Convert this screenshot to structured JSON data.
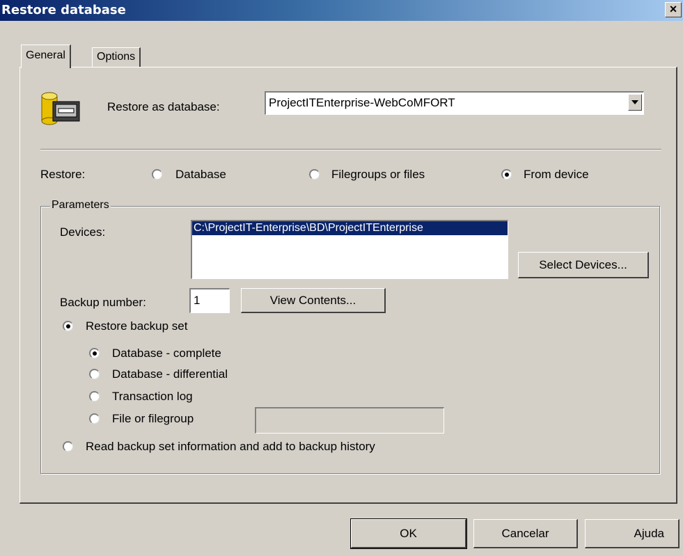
{
  "window": {
    "title": "Restore database",
    "close_glyph": "×"
  },
  "tabs": [
    {
      "label": "General",
      "active": true
    },
    {
      "label": "Options",
      "active": false
    }
  ],
  "restore_as": {
    "label": "Restore as database:",
    "value": "ProjectITEnterprise-WebCoMFORT",
    "icon": "database-icon"
  },
  "restore": {
    "label": "Restore:",
    "options": [
      {
        "label": "Database",
        "checked": false
      },
      {
        "label": "Filegroups or files",
        "checked": false
      },
      {
        "label": "From device",
        "checked": true
      }
    ]
  },
  "parameters": {
    "label": "Parameters",
    "devices_label": "Devices:",
    "devices": [
      "C:\\ProjectIT-Enterprise\\BD\\ProjectITEnterprise"
    ],
    "select_devices_label": "Select Devices...",
    "backup_number_label": "Backup number:",
    "backup_number_value": "1",
    "view_contents_label": "View Contents...",
    "restore_backup_set": {
      "label": "Restore backup set",
      "checked": true
    },
    "backup_types": [
      {
        "label": "Database - complete",
        "checked": true
      },
      {
        "label": "Database - differential",
        "checked": false
      },
      {
        "label": "Transaction log",
        "checked": false
      },
      {
        "label": "File or filegroup",
        "checked": false
      }
    ],
    "file_or_filegroup_value": "",
    "read_backup_info": {
      "label": "Read backup set information and add to backup history",
      "checked": false
    }
  },
  "footer": {
    "ok": "OK",
    "cancel": "Cancelar",
    "help": "Ajuda"
  },
  "colors": {
    "face": "#d4d0c8",
    "title_start": "#0a246a",
    "title_end": "#a6caf0",
    "selection": "#0a246a"
  }
}
